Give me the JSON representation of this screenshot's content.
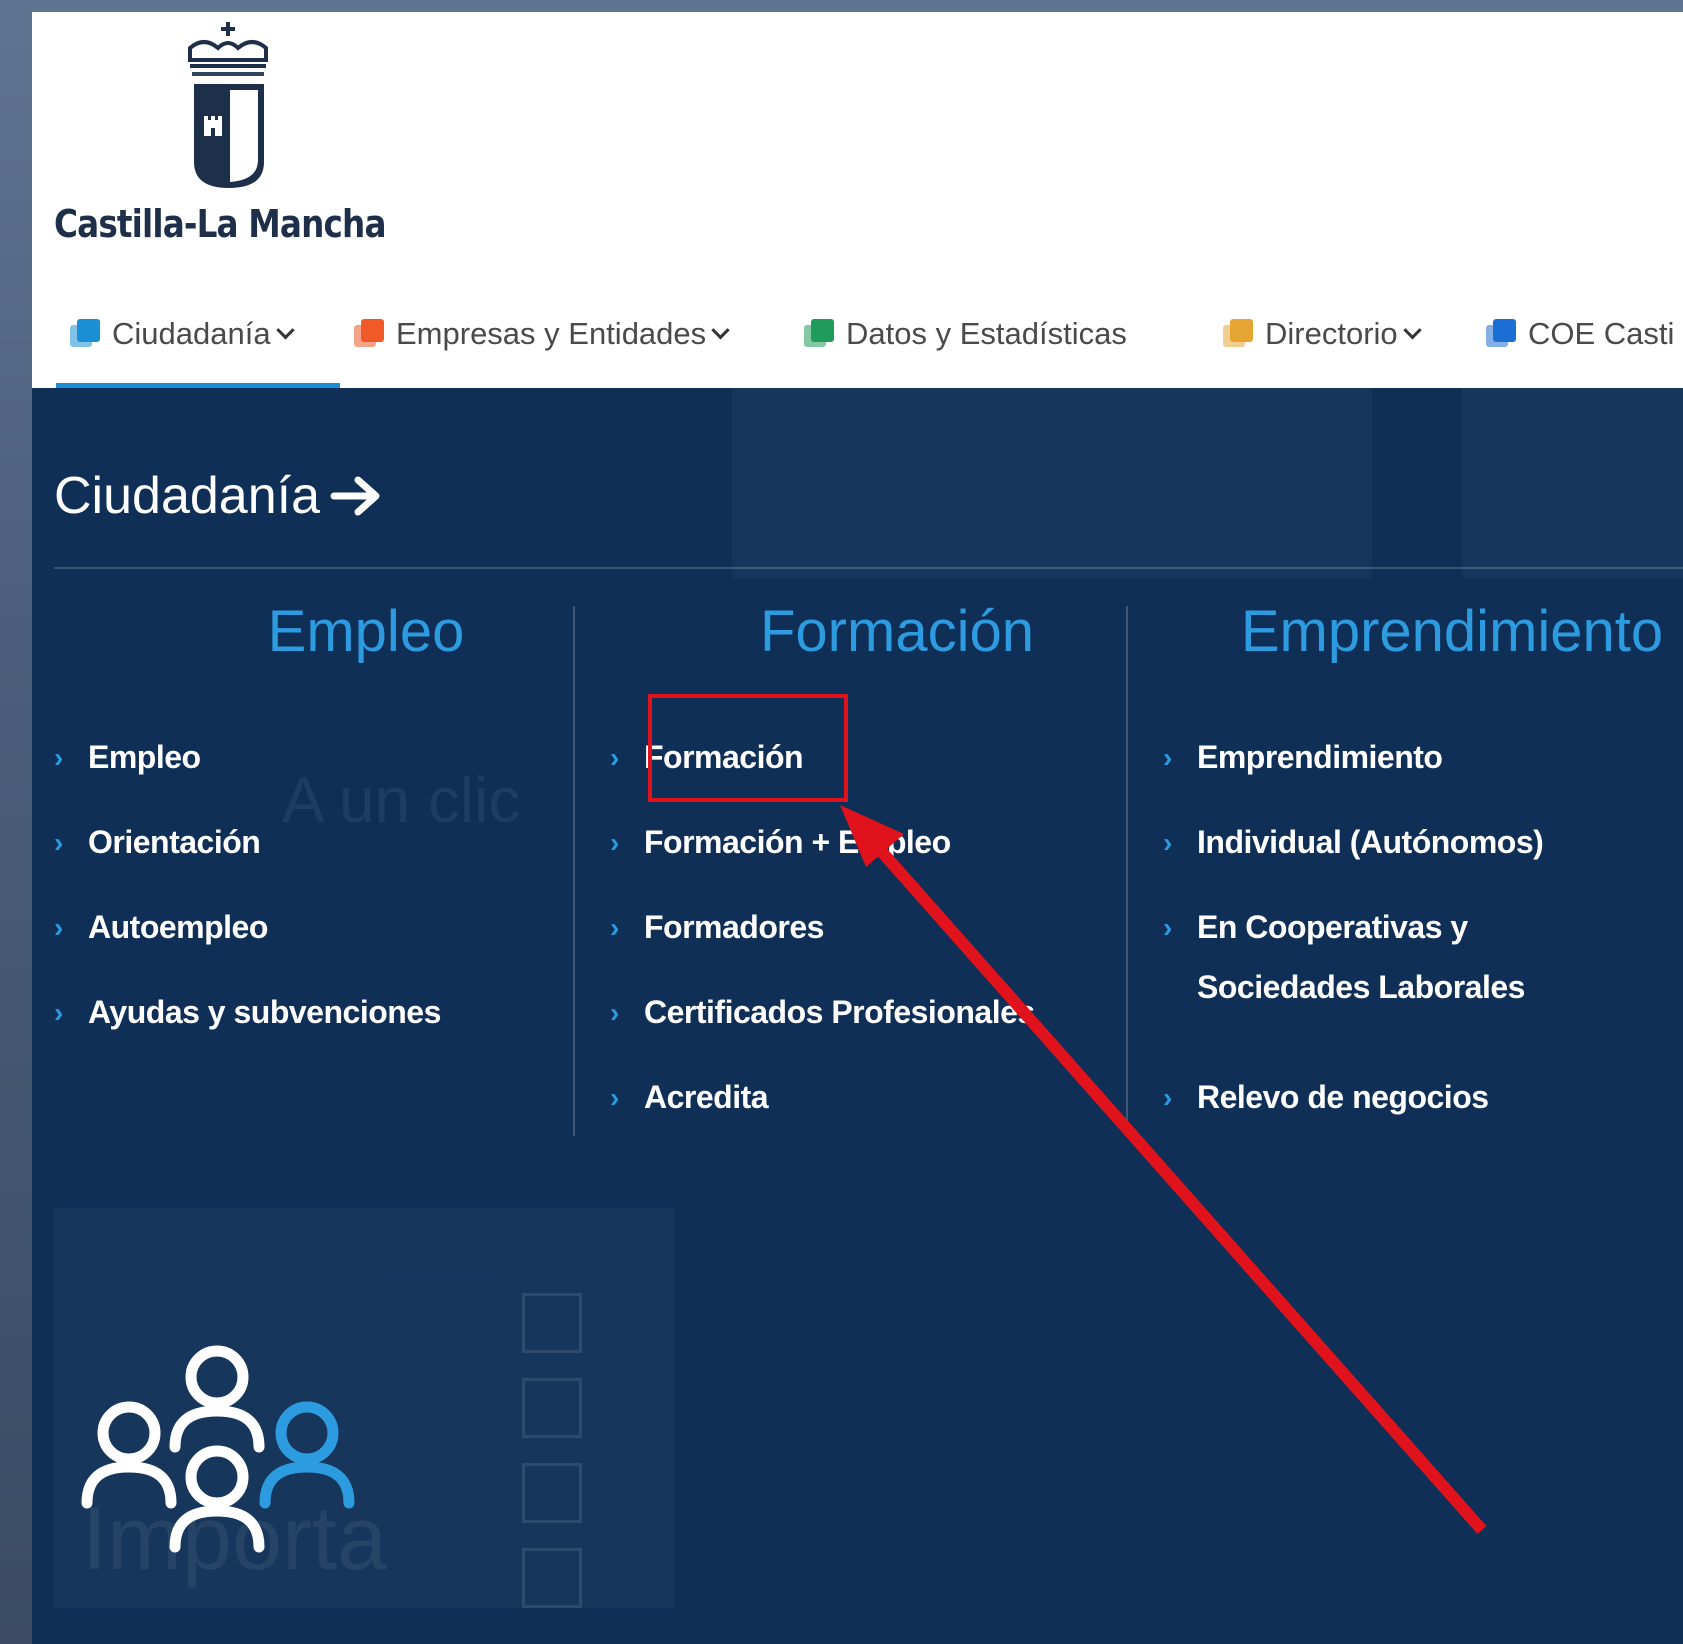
{
  "header": {
    "logo_text": "Castilla-La Mancha",
    "nav": [
      {
        "label": "Ciudadanía",
        "has_dropdown": true,
        "color": "#1b8fd4"
      },
      {
        "label": "Empresas y Entidades",
        "has_dropdown": true,
        "color": "#ef5a28"
      },
      {
        "label": "Datos y Estadísticas",
        "has_dropdown": false,
        "color": "#1f9b5a"
      },
      {
        "label": "Directorio",
        "has_dropdown": true,
        "color": "#e6a532"
      },
      {
        "label": "COE Casti",
        "has_dropdown": false,
        "color": "#1b6fd4"
      }
    ]
  },
  "mega_menu": {
    "title": "Ciudadanía",
    "columns": [
      {
        "heading": "Empleo",
        "links": [
          "Empleo",
          "Orientación",
          "Autoempleo",
          "Ayudas y subvenciones"
        ]
      },
      {
        "heading": "Formación",
        "links": [
          "Formación",
          "Formación + Empleo",
          "Formadores",
          "Certificados Profesionales",
          "Acredita"
        ]
      },
      {
        "heading": "Emprendimiento",
        "links": [
          "Emprendimiento",
          "Individual (Autónomos)",
          "En Cooperativas y Sociedades Laborales",
          "Relevo de negocios"
        ]
      }
    ]
  },
  "annotation": {
    "highlight_target": "Formación",
    "color": "#e0121b"
  },
  "colors": {
    "menu_bg": "#0f2f57",
    "accent": "#2d9be0",
    "link": "#ffffff"
  }
}
